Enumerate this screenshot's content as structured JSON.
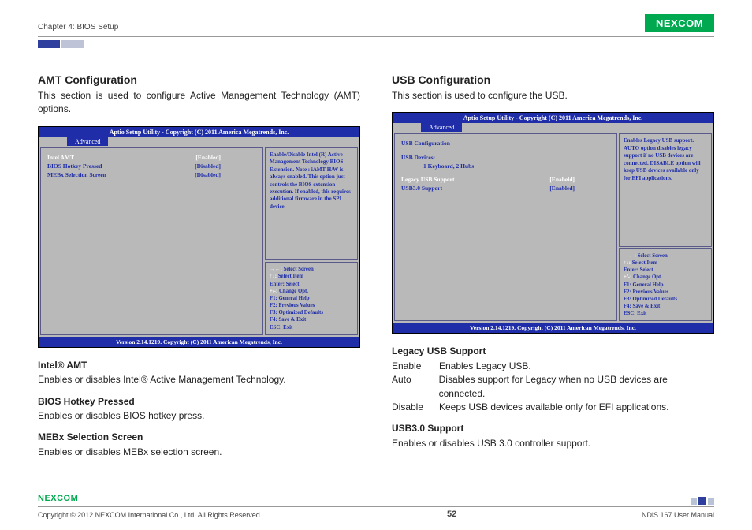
{
  "header": {
    "chapter": "Chapter 4: BIOS Setup",
    "brand": "NEXCOM"
  },
  "left": {
    "title": "AMT Configuration",
    "intro": "This section is used to configure Active Management Technology (AMT) options.",
    "bios": {
      "title": "Aptio Setup Utility - Copyright (C) 2011 America Megatrends, Inc.",
      "tab": "Advanced",
      "rows": [
        {
          "label": "Intel AMT",
          "value": "[Enabled]",
          "white": true
        },
        {
          "label": "BIOS Hotkey Pressed",
          "value": "[Disabled]",
          "white": false
        },
        {
          "label": "MEBx Selection Screen",
          "value": "[Disabled]",
          "white": false
        }
      ],
      "help": "Enable/Disable Intel (R) Active Management Technology BIOS Extension.\nNote : iAMT H/W is always enabled.\nThis option just controls the BIOS extension execution. If enabled, this requires additional firmware in the SPI device",
      "footer": "Version 2.14.1219. Copyright (C) 2011 American Megatrends, Inc."
    },
    "desc": [
      {
        "h": "Intel® AMT",
        "p": "Enables or disables Intel® Active Management Technology."
      },
      {
        "h": "BIOS Hotkey Pressed",
        "p": "Enables or disables BIOS hotkey press."
      },
      {
        "h": "MEBx Selection Screen",
        "p": "Enables or disables MEBx selection screen."
      }
    ]
  },
  "right": {
    "title": "USB Configuration",
    "intro": "This section is used to configure the USB.",
    "bios": {
      "title": "Aptio Setup Utility - Copyright (C) 2011 America Megatrends, Inc.",
      "tab": "Advanced",
      "heading": "USB Configuration",
      "devices_label": "USB Devices:",
      "devices_value": "1 Keyboard, 2 Hubs",
      "rows": [
        {
          "label": "Legacy USB Support",
          "value": "[Enabeld]",
          "white": true
        },
        {
          "label": "USB3.0 Support",
          "value": "[Enabled]",
          "white": false
        }
      ],
      "help": "Enables Legacy USB support. AUTO option disables legacy support if no USB devices are connected. DISABLE option will keep USB devices available only for EFI applications.",
      "footer": "Version 2.14.1219. Copyright (C) 2011 American Megatrends, Inc."
    },
    "desc_h1": "Legacy USB Support",
    "desc_rows": [
      {
        "k": "Enable",
        "v": "Enables Legacy USB."
      },
      {
        "k": "Auto",
        "v": "Disables support for Legacy when no USB devices are connected."
      },
      {
        "k": "Disable",
        "v": "Keeps USB devices available only for EFI applications."
      }
    ],
    "desc_h2": "USB3.0 Support",
    "desc_p2": "Enables or disables USB 3.0 controller support."
  },
  "bios_keys": {
    "l1a": "→←: ",
    "l1b": "Select Screen",
    "l2a": "↑↓: ",
    "l2b": "Select Item",
    "l3": "Enter: Select",
    "l4a": "+/-: ",
    "l4b": "Change Opt.",
    "l5": "F1: General Help",
    "l6": "F2: Previous Values",
    "l7": "F3: Optimized Defaults",
    "l8": "F4: Save & Exit",
    "l9": "ESC: Exit"
  },
  "footer": {
    "copyright": "Copyright © 2012 NEXCOM International Co., Ltd. All Rights Reserved.",
    "page": "52",
    "doc": "NDiS 167 User Manual"
  }
}
